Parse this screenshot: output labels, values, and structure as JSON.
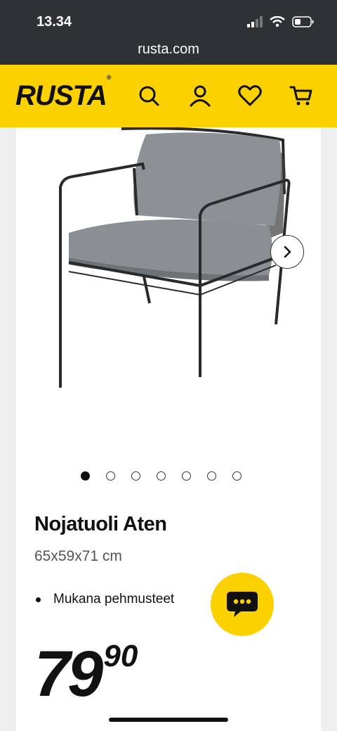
{
  "status": {
    "time": "13.34"
  },
  "browser": {
    "url": "rusta.com"
  },
  "header": {
    "logo": "RUSTA"
  },
  "gallery": {
    "image_count": 7,
    "active_index": 0
  },
  "product": {
    "title": "Nojatuoli Aten",
    "dimensions": "65x59x71 cm",
    "bullets": [
      "Mukana pehmusteet"
    ],
    "price_main": "79",
    "price_cents": "90"
  },
  "icons": [
    "search-icon",
    "account-icon",
    "heart-icon",
    "cart-icon",
    "chevron-right-icon",
    "chat-icon"
  ],
  "colors": {
    "brand_yellow": "#fbd100",
    "dark_bar": "#2f3235"
  }
}
